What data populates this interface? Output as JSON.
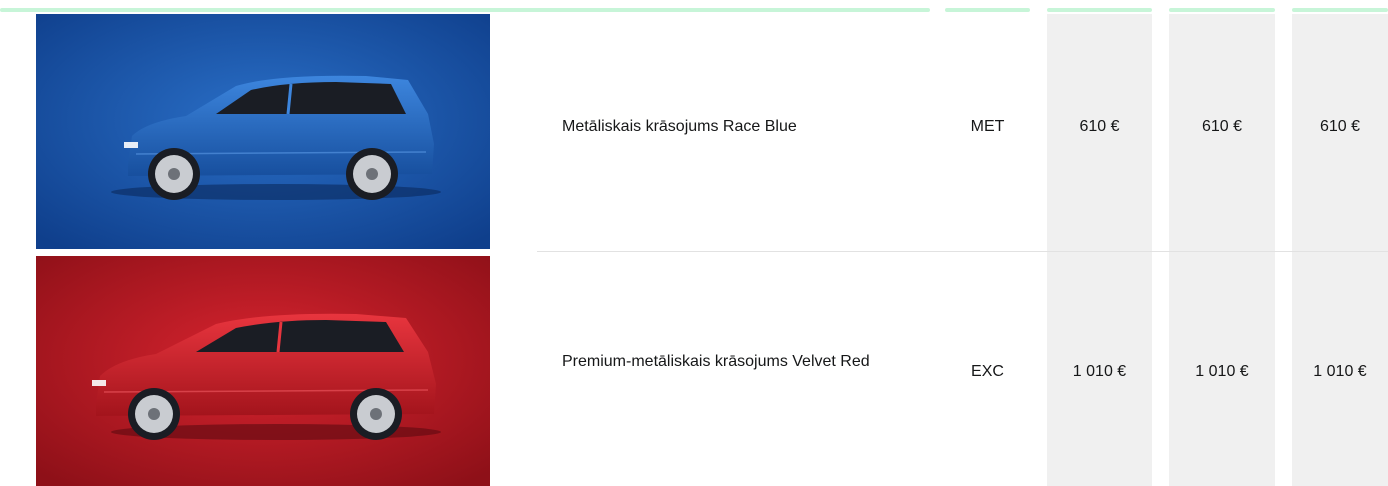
{
  "colors": {
    "accent": "#c7f5d8",
    "price_column_bg": "#f0f0f0",
    "race_blue": "#1e5fb8",
    "velvet_red": "#c21d28"
  },
  "rows": [
    {
      "image_icon": "car-race-blue-icon",
      "name": "Metāliskais krāsojums Race Blue",
      "code": "MET",
      "prices": [
        "610 €",
        "610 €",
        "610 €"
      ]
    },
    {
      "image_icon": "car-velvet-red-icon",
      "name": "Premium-metāliskais krāsojums Velvet Red",
      "code": "EXC",
      "prices": [
        "1 010 €",
        "1 010 €",
        "1 010 €"
      ]
    }
  ]
}
